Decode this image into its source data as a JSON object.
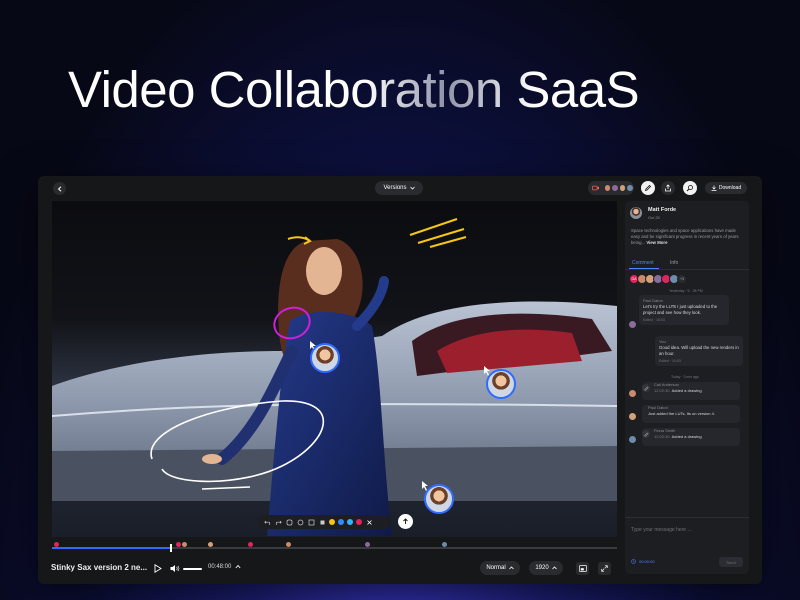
{
  "hero": {
    "title": "Video Collaboration SaaS"
  },
  "topbar": {
    "versions_label": "Versions",
    "download_label": "Download"
  },
  "player": {
    "video_title": "Stinky Sax version 2 ne...",
    "time": "00:48:00",
    "speed": "Normal",
    "resolution": "1920",
    "progress": 0.21
  },
  "annotation_colors": [
    "#f5c518",
    "#2f8cff",
    "#36b5ff",
    "#e0245e"
  ],
  "panel": {
    "author": "Matt Forde",
    "date": "Oct 25",
    "description": "Space technologies and space applications have made easy and be significant progress in recent years of years being...",
    "view_more": "View More",
    "tabs": {
      "comment": "Comment",
      "info": "Info"
    },
    "avatar_initials": "GA",
    "avatar_more": "+3",
    "date_separator_1": "Yesterday · 5 · 28 PM",
    "msg1": {
      "name": "Paul Daton",
      "text": "Let's try the LUTs I just uploaded to the project and see how they look.",
      "meta": "Edited · 18:53"
    },
    "msg2": {
      "name": "You",
      "text": "Good idea. Will upload the new renders in an hour.",
      "meta": "Edited · 10:53"
    },
    "date_separator_2": "Today · 3 min ago",
    "activities": [
      {
        "name": "Cali Anderson",
        "time": "12:02:30",
        "text": "Added a drawing"
      },
      {
        "name": "Paul Daton",
        "time": "",
        "text": "Just added the LUTs. Its on version 4."
      },
      {
        "name": "Fiona Smith",
        "time": "12:02:30",
        "text": "Added a drawing"
      }
    ],
    "input_placeholder": "Type your message here ...",
    "input_time": "00:00:00",
    "send_label": "Send"
  }
}
